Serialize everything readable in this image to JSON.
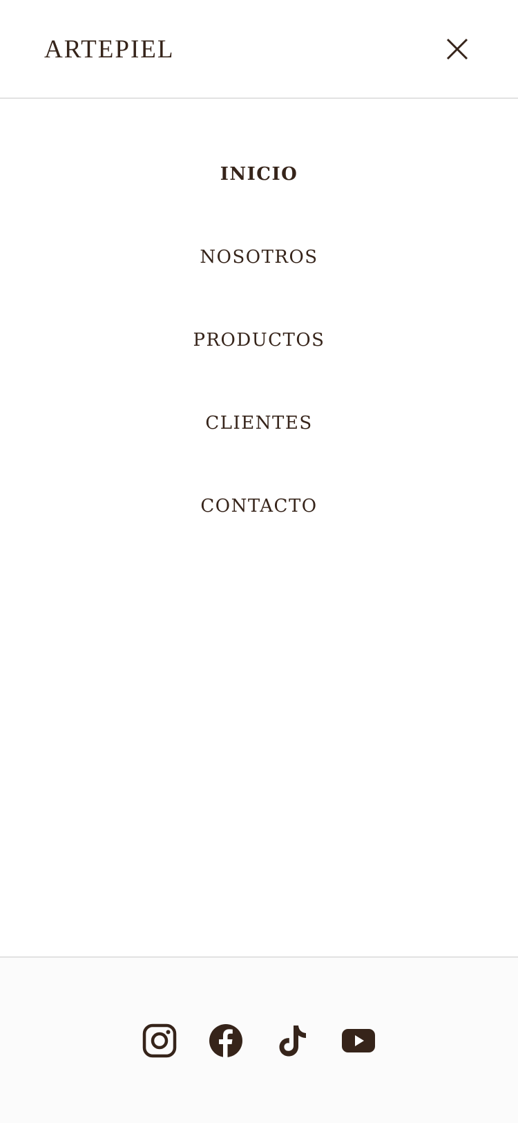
{
  "header": {
    "logo_text": "ARTEPIEL",
    "close_icon": "close-icon"
  },
  "nav": {
    "items": [
      {
        "label": "INICIO",
        "active": true
      },
      {
        "label": "NOSOTROS",
        "active": false
      },
      {
        "label": "PRODUCTOS",
        "active": false
      },
      {
        "label": "CLIENTES",
        "active": false
      },
      {
        "label": "CONTACTO",
        "active": false
      }
    ]
  },
  "footer": {
    "social": [
      {
        "icon": "instagram-icon"
      },
      {
        "icon": "facebook-icon"
      },
      {
        "icon": "tiktok-icon"
      },
      {
        "icon": "youtube-icon"
      }
    ]
  },
  "colors": {
    "text": "#36241a",
    "divider": "#e2e2e2",
    "background": "#ffffff"
  }
}
